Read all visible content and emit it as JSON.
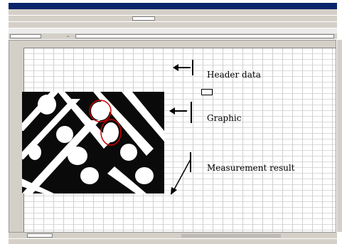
{
  "window": {
    "title": ""
  },
  "menu": {
    "items": [
      "",
      "",
      "",
      "",
      "",
      "",
      "",
      "",
      ""
    ]
  },
  "namebox": {
    "value": ""
  },
  "annotations": {
    "header_data": "Header data",
    "graphic": "Graphic",
    "measurement_result": "Measurement result"
  },
  "header_block": {
    "rows": [
      [
        "",
        ""
      ],
      [
        "",
        ""
      ],
      [
        "",
        ""
      ],
      [
        "",
        ""
      ]
    ]
  },
  "icons": [
    "minimize-icon",
    "maximize-icon",
    "close-icon",
    "arrow-left-icon",
    "arrow-down-left-icon"
  ],
  "colors": {
    "titlebar": "#0a246a",
    "chrome": "#d4d0c8",
    "annotation_circle": "#cc0000"
  }
}
